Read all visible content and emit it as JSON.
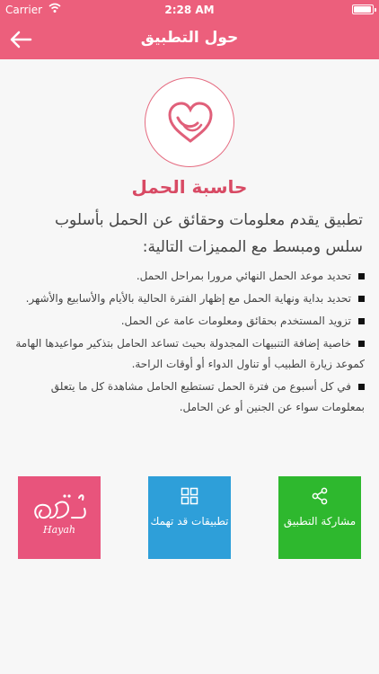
{
  "status_bar": {
    "carrier": "Carrier",
    "time": "2:28 AM",
    "battery_level": 0.95
  },
  "navbar": {
    "title": "حول التطبيق"
  },
  "app": {
    "name": "حاسبة الحمل"
  },
  "intro": "تطبيق يقدم معلومات وحقائق عن الحمل بأسلوب سلس ومبسط مع المميزات التالية:",
  "features": [
    "تحديد موعد الحمل النهائي مرورا بمراحل الحمل.",
    "تحديد بداية ونهاية الحمل مع إظهار الفترة الحالية بالأيام والأسابيع والأشهر.",
    "تزويد المستخدم بحقائق ومعلومات عامة عن الحمل.",
    "خاصية إضافة التنبيهات المجدولة بحيث تساعد الحامل بتذكير مواعيدها الهامة كموعد زيارة الطبيب أو تناول الدواء أو أوقات الراحة.",
    "في كل أسبوع من فترة الحمل تستطيع الحامل مشاهدة كل ما يتعلق بمعلومات سواء عن الجنين أو عن الحامل."
  ],
  "tiles": {
    "share": {
      "label": "مشاركة التطبيق",
      "icon": "share-icon",
      "color": "#2eb82e"
    },
    "apps": {
      "label": "تطبيقات قد تهمك",
      "icon": "grid-icon",
      "color": "#2e9fd9"
    },
    "hayah": {
      "brand": "Hayah",
      "color": "#e8547c"
    }
  }
}
